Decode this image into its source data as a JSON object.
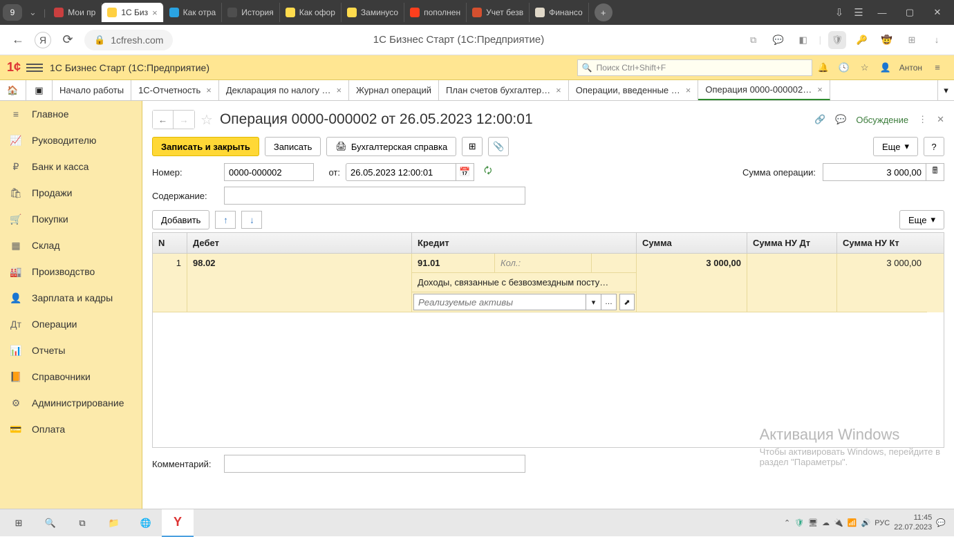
{
  "browser": {
    "tab_count": "9",
    "tabs": [
      {
        "label": "Мои пр",
        "fav": "fav-1c-red"
      },
      {
        "label": "1С Биз",
        "fav": "fav-1c",
        "active": true
      },
      {
        "label": "Как отра",
        "fav": "fav-tg"
      },
      {
        "label": "История",
        "fav": "fav-clock"
      },
      {
        "label": "Как офор",
        "fav": "fav-y"
      },
      {
        "label": "Заминусо",
        "fav": "fav-y"
      },
      {
        "label": "пополнен",
        "fav": "fav-ya"
      },
      {
        "label": "Учет безв",
        "fav": "fav-doc"
      },
      {
        "label": "Финансо",
        "fav": "fav-cat"
      }
    ]
  },
  "address": {
    "url": "1cfresh.com",
    "page_title": "1С Бизнес Старт (1С:Предприятие)"
  },
  "app_header": {
    "title": "1С Бизнес Старт  (1С:Предприятие)",
    "search_placeholder": "Поиск Ctrl+Shift+F",
    "user": "Антон"
  },
  "app_tabs": [
    {
      "label": "Начало работы"
    },
    {
      "label": "1С-Отчетность",
      "closable": true
    },
    {
      "label": "Декларация по налогу …",
      "closable": true
    },
    {
      "label": "Журнал операций"
    },
    {
      "label": "План счетов бухгалтер…",
      "closable": true
    },
    {
      "label": "Операции, введенные …",
      "closable": true
    },
    {
      "label": "Операция 0000-000002…",
      "closable": true,
      "active": true
    }
  ],
  "sidebar": [
    {
      "label": "Главное",
      "icon": "menu"
    },
    {
      "label": "Руководителю",
      "icon": "chart"
    },
    {
      "label": "Банк и касса",
      "icon": "ruble"
    },
    {
      "label": "Продажи",
      "icon": "bag"
    },
    {
      "label": "Покупки",
      "icon": "cart"
    },
    {
      "label": "Склад",
      "icon": "boxes"
    },
    {
      "label": "Производство",
      "icon": "factory"
    },
    {
      "label": "Зарплата и кадры",
      "icon": "person"
    },
    {
      "label": "Операции",
      "icon": "dtkt"
    },
    {
      "label": "Отчеты",
      "icon": "bars"
    },
    {
      "label": "Справочники",
      "icon": "book"
    },
    {
      "label": "Администрирование",
      "icon": "gear"
    },
    {
      "label": "Оплата",
      "icon": "card"
    }
  ],
  "page": {
    "title": "Операция 0000-000002 от 26.05.2023 12:00:01",
    "discuss": "Обсуждение"
  },
  "toolbar": {
    "save_close": "Записать и закрыть",
    "save": "Записать",
    "acct_ref": "Бухгалтерская справка",
    "more": "Еще",
    "help": "?"
  },
  "form": {
    "number_label": "Номер:",
    "number_value": "0000-000002",
    "date_label": "от:",
    "date_value": "26.05.2023 12:00:01",
    "sum_label": "Сумма операции:",
    "sum_value": "3 000,00",
    "content_label": "Содержание:",
    "content_value": "",
    "add": "Добавить",
    "more": "Еще",
    "comment_label": "Комментарий:",
    "comment_value": ""
  },
  "grid": {
    "headers": {
      "n": "N",
      "debit": "Дебет",
      "credit": "Кредит",
      "sum": "Сумма",
      "nu_dt": "Сумма НУ Дт",
      "nu_kt": "Сумма НУ Кт"
    },
    "row": {
      "n": "1",
      "debit_account": "98.02",
      "credit_account": "91.01",
      "credit_qty_label": "Кол.:",
      "credit_desc": "Доходы, связанные с безвозмездным посту…",
      "credit_input_placeholder": "Реализуемые активы",
      "sum": "3 000,00",
      "nu_kt": "3 000,00"
    }
  },
  "watermark": {
    "title": "Активация Windows",
    "line1": "Чтобы активировать Windows, перейдите в",
    "line2": "раздел \"Параметры\"."
  },
  "taskbar": {
    "lang": "РУС",
    "time": "11:45",
    "date": "22.07.2023"
  }
}
